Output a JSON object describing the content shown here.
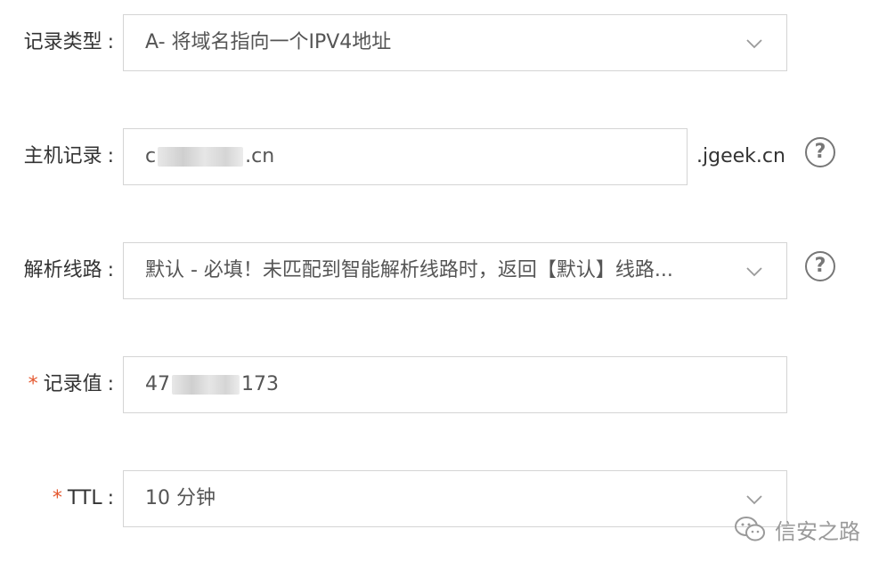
{
  "form": {
    "record_type": {
      "label": "记录类型",
      "colon": ":",
      "value": "A- 将域名指向一个IPV4地址"
    },
    "host_record": {
      "label": "主机记录",
      "colon": ":",
      "value_prefix": "c",
      "value_suffix": ".cn",
      "domain_suffix": ".jgeek.cn",
      "help": "?"
    },
    "resolution_line": {
      "label": "解析线路",
      "colon": ":",
      "value": "默认 - 必填！未匹配到智能解析线路时，返回【默认】线路...",
      "help": "?"
    },
    "record_value": {
      "required_mark": "*",
      "label": "记录值",
      "colon": ":",
      "value_prefix": "47",
      "value_suffix": "173"
    },
    "ttl": {
      "required_mark": "*",
      "label": "TTL",
      "colon": ":",
      "value": "10 分钟"
    }
  },
  "watermark": {
    "text": "信安之路",
    "icon": "wechat-icon"
  },
  "colors": {
    "required": "#e4572e",
    "border": "#d4d4d4",
    "text": "#333333",
    "icon": "#777777"
  }
}
